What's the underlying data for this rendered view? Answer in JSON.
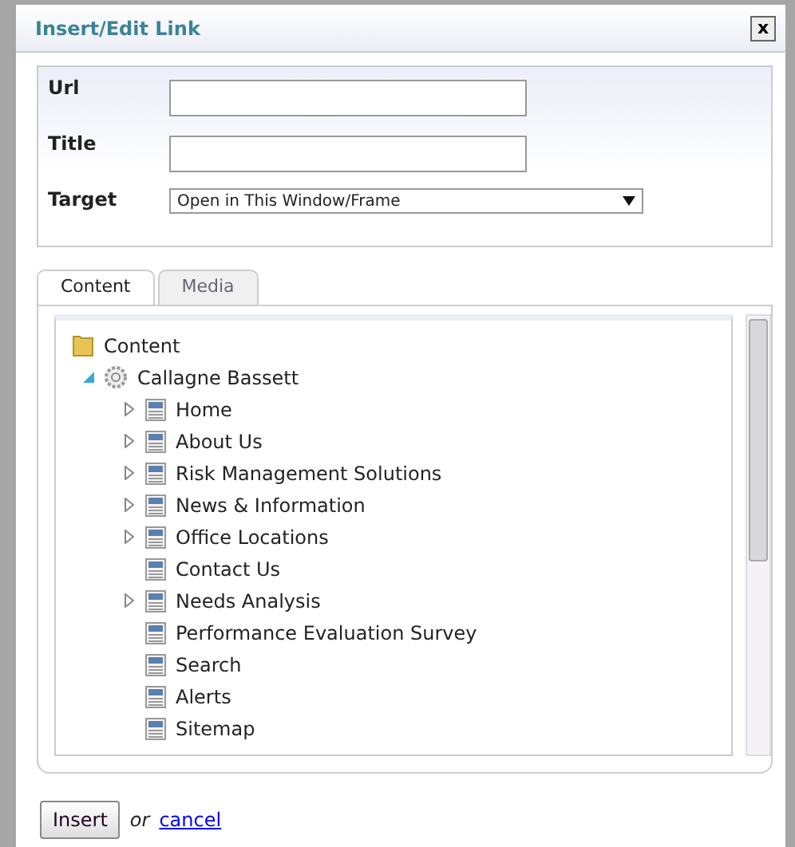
{
  "window": {
    "title": "Insert/Edit Link",
    "close": "x"
  },
  "form": {
    "fields": [
      {
        "kind": "text",
        "label": "Url"
      },
      {
        "kind": "text",
        "label": "Title"
      },
      {
        "kind": "select",
        "label": "Target",
        "value": "Open in This Window/Frame"
      }
    ]
  },
  "tabs": [
    {
      "label": "Content",
      "selected": true
    },
    {
      "label": "Media",
      "selected": false
    }
  ],
  "tree": [
    {
      "kind": "folder",
      "label": "Content",
      "children": [
        {
          "kind": "site",
          "label": "Callagne Bassett",
          "expanded": true,
          "children": [
            {
              "kind": "page",
              "label": "Home",
              "expandable": true
            },
            {
              "kind": "page",
              "label": "About Us",
              "expandable": true
            },
            {
              "kind": "page",
              "label": "Risk Management Solutions",
              "expandable": true
            },
            {
              "kind": "page",
              "label": "News & Information",
              "expandable": true
            },
            {
              "kind": "page",
              "label": "Office Locations",
              "expandable": true
            },
            {
              "kind": "page",
              "label": "Contact Us",
              "expandable": false
            },
            {
              "kind": "page",
              "label": "Needs Analysis",
              "expandable": true
            },
            {
              "kind": "page",
              "label": "Performance Evaluation Survey",
              "expandable": false
            },
            {
              "kind": "page",
              "label": "Search",
              "expandable": false
            },
            {
              "kind": "page",
              "label": "Alerts",
              "expandable": false
            },
            {
              "kind": "page",
              "label": "Sitemap",
              "expandable": false
            }
          ]
        }
      ]
    }
  ],
  "footer": {
    "button": "Insert",
    "or": "or",
    "link": "cancel"
  }
}
